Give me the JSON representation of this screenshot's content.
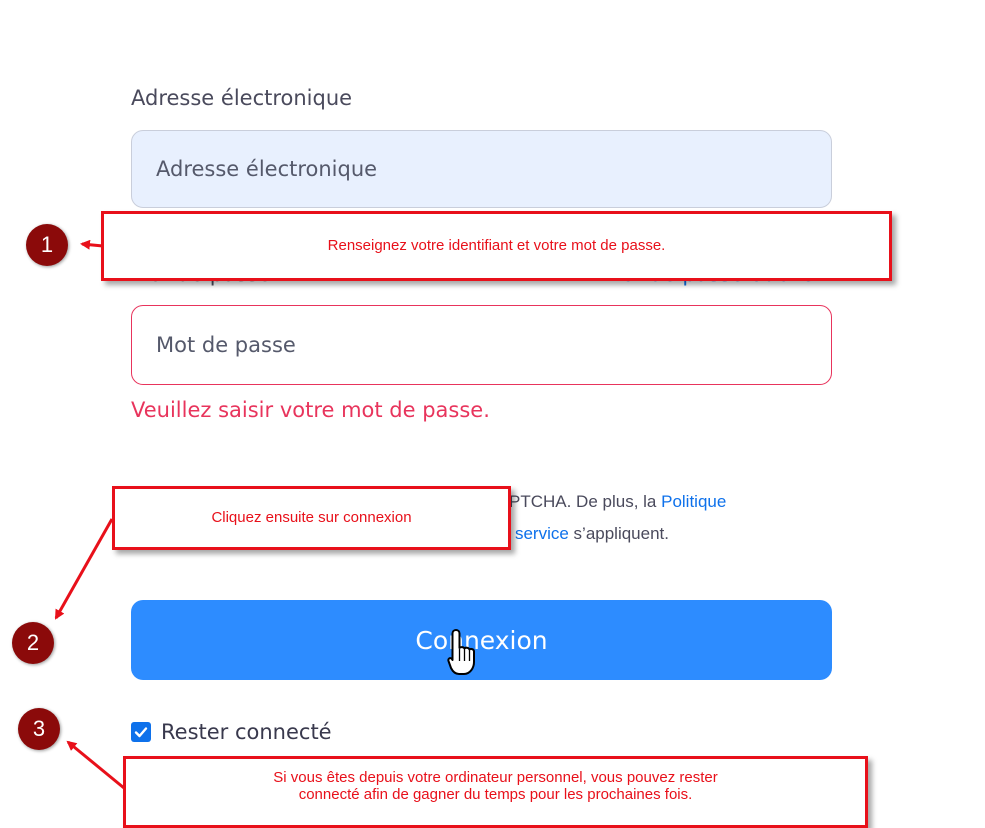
{
  "form": {
    "email_label": "Adresse électronique",
    "email_placeholder": "Adresse électronique",
    "password_label": "Mot de passe",
    "forgot_password": "Mot de passe oublié ?",
    "password_placeholder": "Mot de passe",
    "password_error": "Veuillez saisir votre mot de passe.",
    "recaptcha_line1_text": "PTCHA. De plus, la ",
    "recaptcha_line1_link": "Politique",
    "recaptcha_line2_link": "le service",
    "recaptcha_line2_text": " s’appliquent.",
    "submit_label": "Connexion",
    "remember_label": "Rester connecté",
    "remember_checked": true
  },
  "annotations": {
    "note_1": "Renseignez votre identifiant et votre mot de passe.",
    "note_2": "Cliquez ensuite sur connexion",
    "note_3_line1": "Si vous êtes depuis votre ordinateur personnel, vous pouvez rester",
    "note_3_line2": "connecté afin de gagner du temps pour les prochaines fois.",
    "badge_1": "1",
    "badge_2": "2",
    "badge_3": "3"
  },
  "colors": {
    "primary_button": "#2d8cff",
    "error": "#e8345c",
    "link": "#0e71eb",
    "annotation_red": "#e8101a",
    "badge_dark_red": "#8b0a0a"
  },
  "icons": {
    "checkbox": "checkmark-icon",
    "cursor": "hand-pointer-icon"
  }
}
